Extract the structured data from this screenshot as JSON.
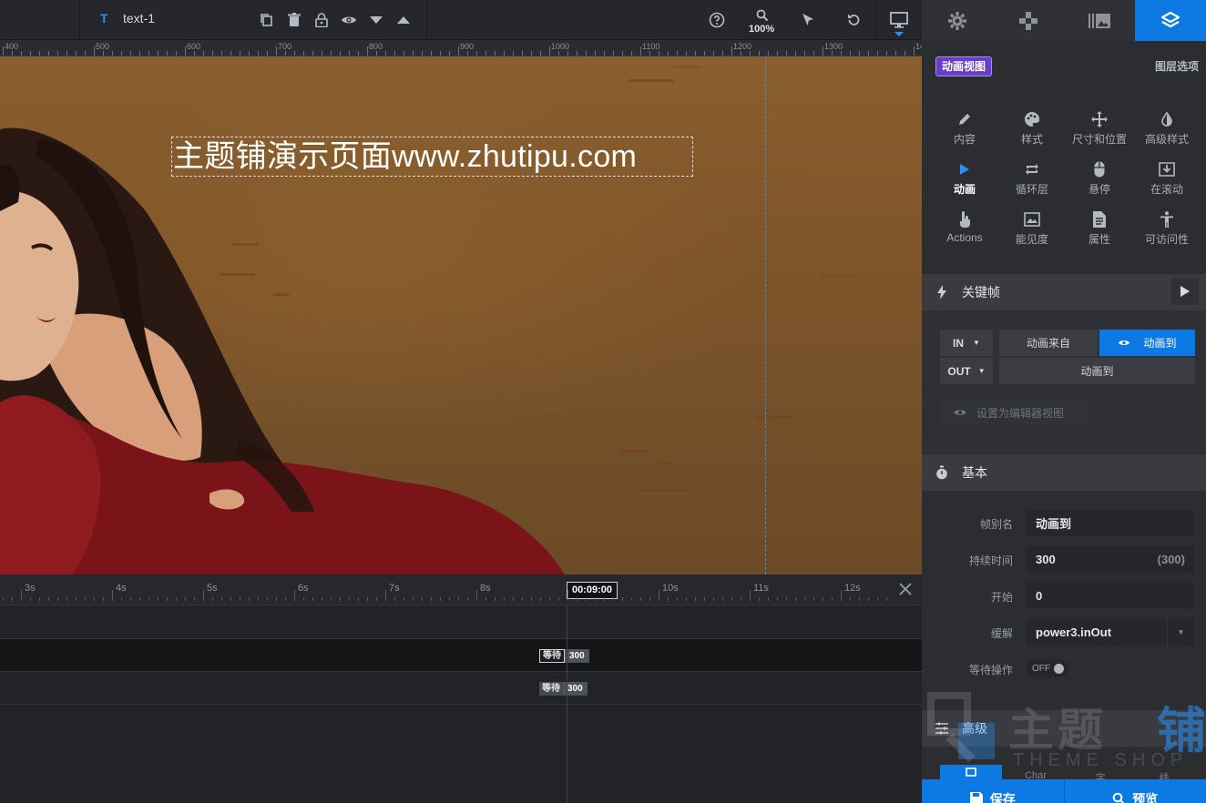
{
  "toolbar": {
    "layer_type": "T",
    "layer_name": "text-1",
    "zoom": "100%"
  },
  "ruler": {
    "labels": [
      "400",
      "500",
      "600",
      "700",
      "800",
      "900",
      "1000",
      "1100",
      "1200",
      "1300",
      "14"
    ]
  },
  "canvas": {
    "text": "主题铺演示页面www.zhutipu.com"
  },
  "timeline": {
    "seconds": [
      "3s",
      "4s",
      "5s",
      "6s",
      "7s",
      "8s",
      "10s",
      "11s",
      "12s"
    ],
    "current_time": "00:09:00",
    "rows": [
      {
        "wait_label": "等待",
        "duration": "300"
      },
      {
        "wait_label": "等待",
        "duration": "300"
      }
    ]
  },
  "panel": {
    "view_badge": "动画视图",
    "layer_options": "图层选项",
    "menu": [
      {
        "label": "内容",
        "icon": "pencil-icon"
      },
      {
        "label": "样式",
        "icon": "palette-icon"
      },
      {
        "label": "尺寸和位置",
        "icon": "move-icon"
      },
      {
        "label": "高级样式",
        "icon": "contrast-icon"
      },
      {
        "label": "动画",
        "icon": "play-icon"
      },
      {
        "label": "循环层",
        "icon": "loop-icon"
      },
      {
        "label": "悬停",
        "icon": "mouse-icon"
      },
      {
        "label": "在滚动",
        "icon": "scroll-download-icon"
      },
      {
        "label": "Actions",
        "icon": "hand-pointer-icon"
      },
      {
        "label": "能见度",
        "icon": "visibility-icon"
      },
      {
        "label": "属性",
        "icon": "document-icon"
      },
      {
        "label": "可访问性",
        "icon": "accessibility-icon"
      }
    ],
    "keyframes": {
      "title": "关键帧",
      "in_label": "IN",
      "out_label": "OUT",
      "anim_from": "动画来自",
      "anim_to": "动画到",
      "out_anim_to": "动画到",
      "set_editor_view": "设置为编辑器视图"
    },
    "basic": {
      "title": "基本",
      "frame_name_label": "帧别名",
      "frame_name": "动画到",
      "duration_label": "持续时间",
      "duration": "300",
      "duration_suffix": "(300)",
      "start_label": "开始",
      "start": "0",
      "ease_label": "缓解",
      "ease": "power3.inOut",
      "wait_label": "等待操作",
      "wait_state": "OFF"
    },
    "advanced": {
      "title": "高级",
      "tabs": [
        "Char",
        "字",
        "线"
      ]
    },
    "save_label": "保存",
    "preview_label": "预览"
  },
  "watermark": {
    "text": "主题",
    "blue_text": "铺",
    "sub": "THEME SHOP"
  },
  "colors": {
    "accent": "#0d7ae4",
    "badge": "#6a3dc8"
  }
}
